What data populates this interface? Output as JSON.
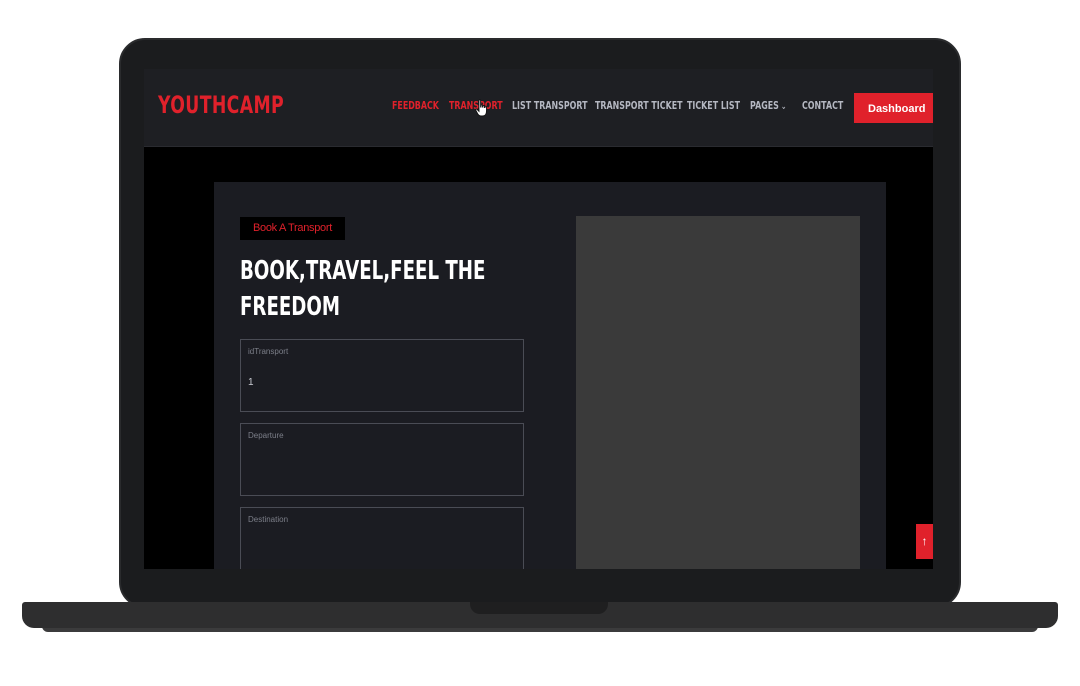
{
  "brand": "YOUTHCAMP",
  "nav": {
    "items": [
      {
        "label": "FEEDBACK",
        "active": true
      },
      {
        "label": "TRANSPORT",
        "active": true
      },
      {
        "label": "LIST TRANSPORT",
        "active": false
      },
      {
        "label": "TRANSPORT TICKET",
        "active": false
      },
      {
        "label": "TICKET LIST",
        "active": false
      },
      {
        "label": "PAGES",
        "active": false,
        "has_dropdown": true
      },
      {
        "label": "CONTACT",
        "active": false
      }
    ],
    "dashboard_label": "Dashboard"
  },
  "hero": {
    "badge": "Book A Transport",
    "title": "BOOK,TRAVEL,FEEL THE FREEDOM"
  },
  "form": {
    "fields": [
      {
        "label": "idTransport",
        "value": "1"
      },
      {
        "label": "Departure",
        "value": ""
      },
      {
        "label": "Destination",
        "value": ""
      }
    ]
  },
  "colors": {
    "accent": "#e0212b",
    "nav_bg": "#1e1f23",
    "card_bg": "#1b1c22",
    "image_placeholder": "#3a3a3a"
  },
  "icons": {
    "dashboard": "arrow-right-icon",
    "pages_dropdown": "chevron-down-icon",
    "scroll_top": "arrow-up-icon",
    "cursor": "hand-pointer-icon"
  }
}
